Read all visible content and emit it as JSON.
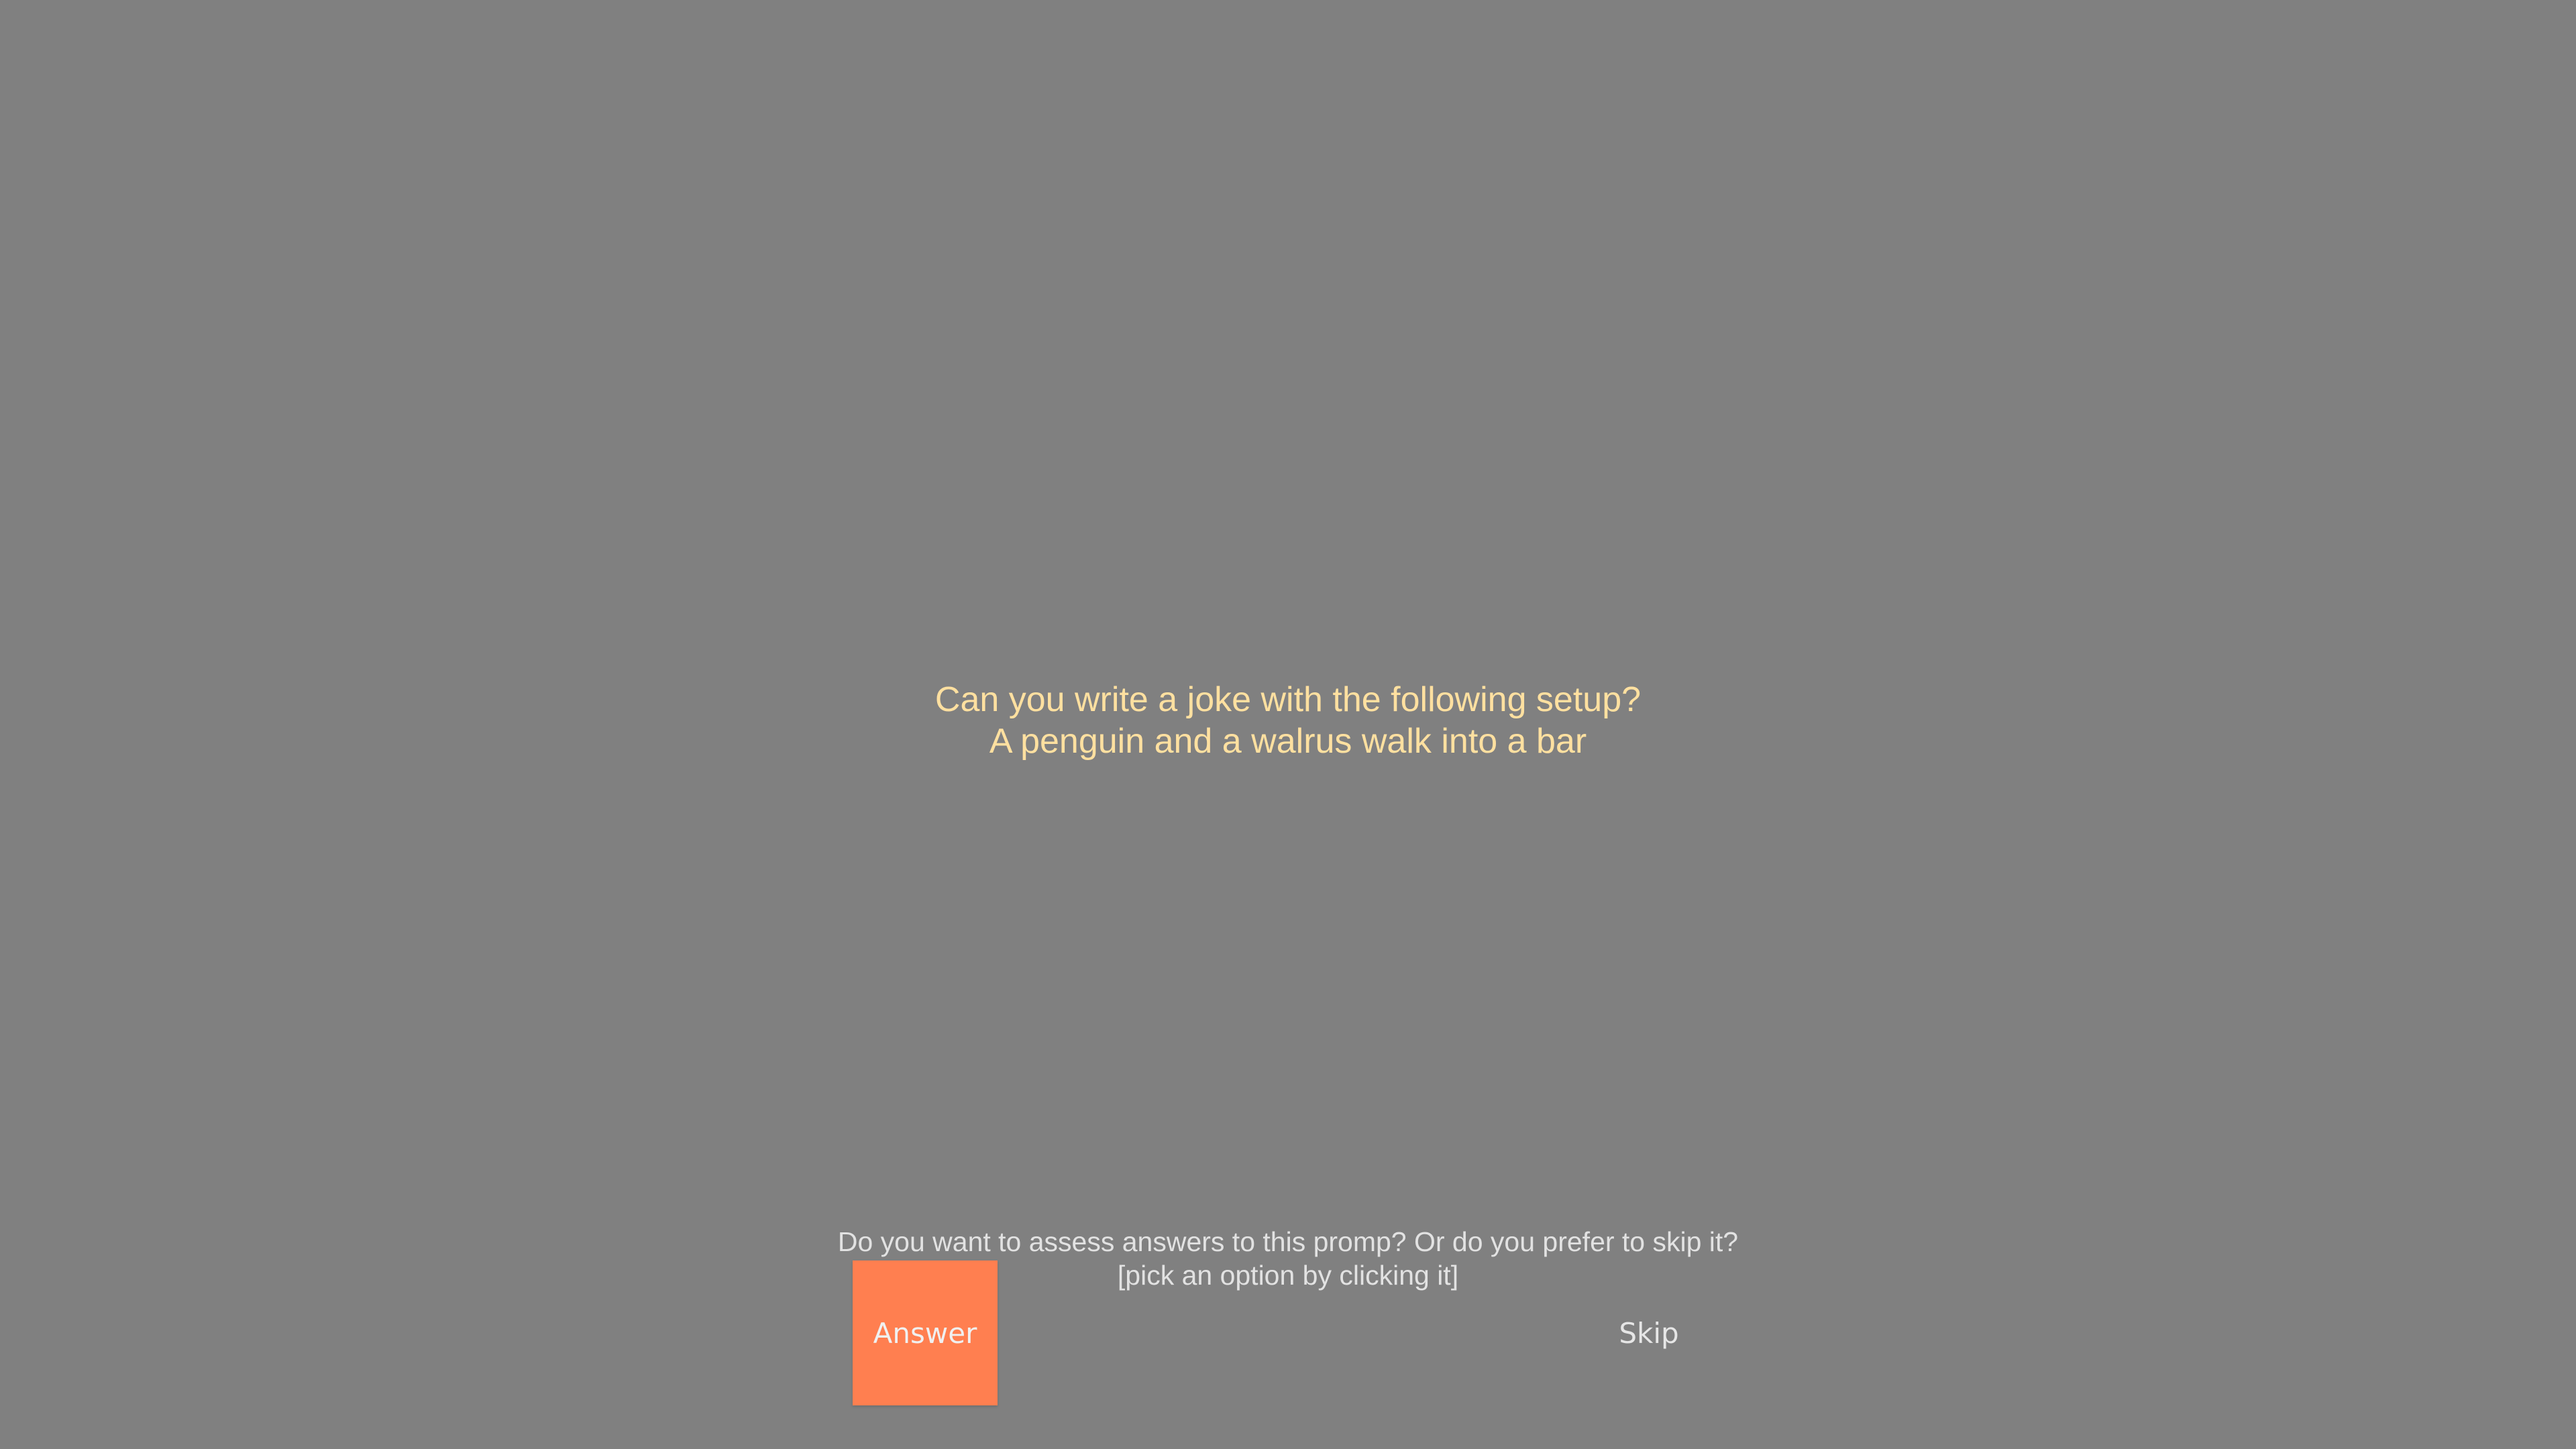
{
  "prompt": {
    "line1": "Can you write a joke with the following setup?",
    "line2": "A penguin and a walrus walk into a bar"
  },
  "question": {
    "line1": "Do you want to assess answers to this promp?  Or do you prefer to skip it?",
    "line2": "[pick an option by clicking it]"
  },
  "buttons": {
    "answer_label": "Answer",
    "skip_label": "Skip"
  },
  "colors": {
    "background": "#808080",
    "prompt_text": "#ffe0a0",
    "answer_button": "#ff7f50"
  }
}
